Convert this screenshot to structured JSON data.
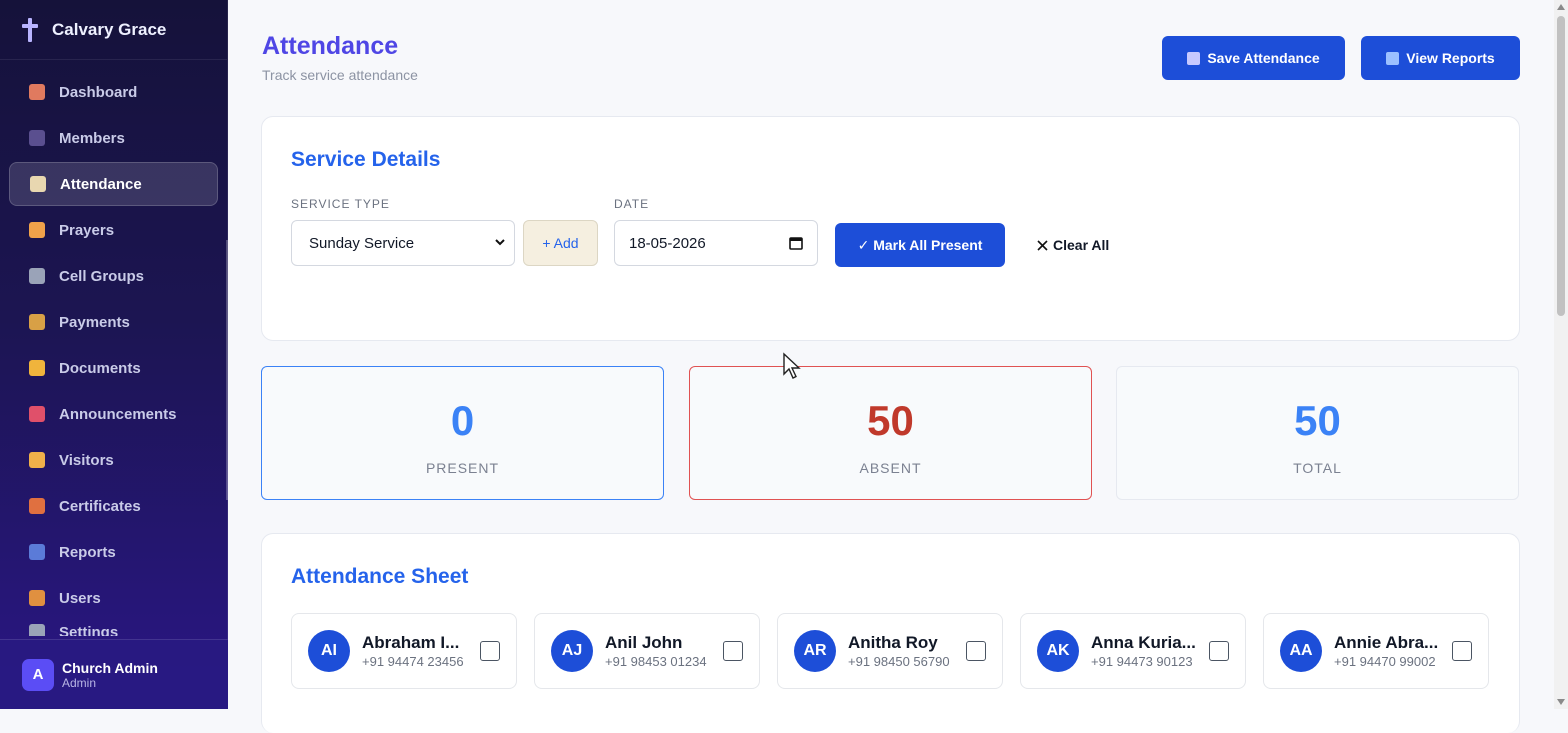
{
  "app": {
    "name": "Calvary Grace"
  },
  "sidebar": {
    "items": [
      {
        "label": "Dashboard",
        "icon": "house-icon",
        "color": "#e07a5f"
      },
      {
        "label": "Members",
        "icon": "people-icon",
        "color": "#5a4f8f"
      },
      {
        "label": "Attendance",
        "icon": "clipboard-icon",
        "color": "#e8d7b0"
      },
      {
        "label": "Prayers",
        "icon": "praying-hands-icon",
        "color": "#f0a24a"
      },
      {
        "label": "Cell Groups",
        "icon": "link-icon",
        "color": "#9aa3b8"
      },
      {
        "label": "Payments",
        "icon": "money-bag-icon",
        "color": "#d8a046"
      },
      {
        "label": "Documents",
        "icon": "folder-icon",
        "color": "#f0b43c"
      },
      {
        "label": "Announcements",
        "icon": "megaphone-icon",
        "color": "#e0506a"
      },
      {
        "label": "Visitors",
        "icon": "waving-hand-icon",
        "color": "#f0b04a"
      },
      {
        "label": "Certificates",
        "icon": "medal-icon",
        "color": "#e07040"
      },
      {
        "label": "Reports",
        "icon": "bar-chart-icon",
        "color": "#5b7bd8"
      },
      {
        "label": "Users",
        "icon": "lock-icon",
        "color": "#e09040"
      },
      {
        "label": "Settings",
        "icon": "gear-icon",
        "color": "#9aa3b8"
      }
    ],
    "user": {
      "initial": "A",
      "name": "Church Admin",
      "role": "Admin"
    }
  },
  "header": {
    "title": "Attendance",
    "subtitle": "Track service attendance",
    "save_label": "Save Attendance",
    "reports_label": "View Reports"
  },
  "service_details": {
    "title": "Service Details",
    "service_type_label": "SERVICE TYPE",
    "service_type_value": "Sunday Service",
    "add_label": "+ Add",
    "date_label": "DATE",
    "date_value": "18-05-2026",
    "mark_all_label": "✓ Mark All Present",
    "clear_all_label": "Clear All"
  },
  "stats": [
    {
      "value": "0",
      "label": "PRESENT",
      "color": "#3b82f6"
    },
    {
      "value": "50",
      "label": "ABSENT",
      "color": "#c0392b"
    },
    {
      "value": "50",
      "label": "TOTAL",
      "color": "#3b82f6"
    }
  ],
  "attendance_sheet": {
    "title": "Attendance Sheet",
    "members": [
      {
        "initials": "AI",
        "name": "Abraham I...",
        "phone": "+91 94474 23456"
      },
      {
        "initials": "AJ",
        "name": "Anil John",
        "phone": "+91 98453 01234"
      },
      {
        "initials": "AR",
        "name": "Anitha Roy",
        "phone": "+91 98450 56790"
      },
      {
        "initials": "AK",
        "name": "Anna Kuria...",
        "phone": "+91 94473 90123"
      },
      {
        "initials": "AA",
        "name": "Annie Abra...",
        "phone": "+91 94470 99002"
      }
    ]
  },
  "colors": {
    "accent": "#1d4ed8",
    "title": "#4f46e5",
    "section_title": "#2563eb",
    "present_border": "#3b82f6",
    "absent_border": "#e05252"
  }
}
